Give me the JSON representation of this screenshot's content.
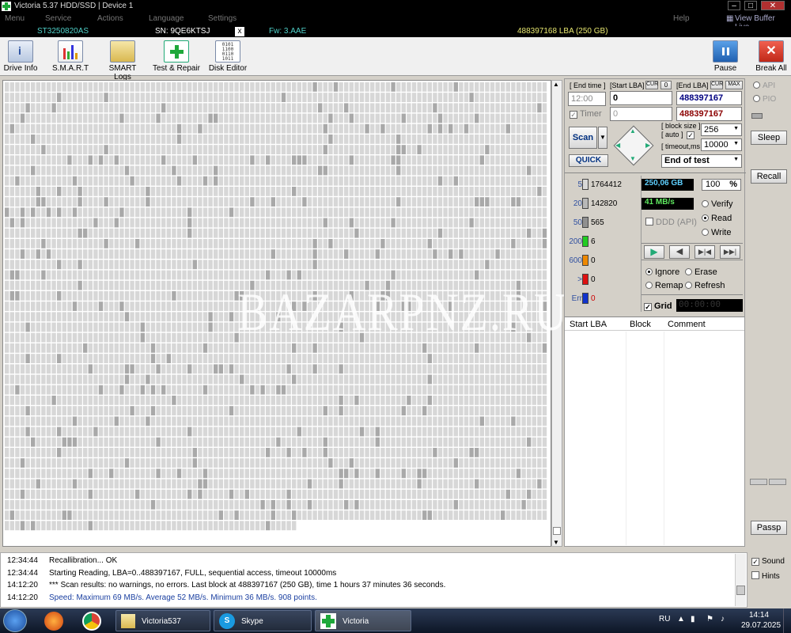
{
  "window": {
    "title": "Victoria 5.37 HDD/SSD | Device 1"
  },
  "menu": [
    "Menu",
    "Service",
    "Actions",
    "Language",
    "Settings"
  ],
  "help": "Help",
  "view_buffer": "View Buffer Live",
  "drive": {
    "model": "ST3250820AS",
    "serial": "SN: 9QE6KTSJ",
    "close": "x",
    "fw": "Fw: 3.AAE",
    "lba_info": "488397168 LBA (250 GB)"
  },
  "toolbar": {
    "drive_info": "Drive Info",
    "smart": "S.M.A.R.T",
    "smart_logs": "SMART Logs",
    "test_repair": "Test & Repair",
    "disk_editor": "Disk Editor",
    "pause": "Pause",
    "break_all": "Break All"
  },
  "params": {
    "end_time_label": "[ End time ]",
    "start_lba_label": "[Start LBA]",
    "cur_label": "CUR",
    "zero_label": "0",
    "end_lba_label": "[End LBA]",
    "cur2_label": "CUR",
    "max_label": "MAX",
    "end_time_value": "12:00",
    "start_lba_value": "0",
    "end_lba_value": "488397167",
    "timer_label": "Timer",
    "timer_value": "0",
    "end_lba_value2": "488397167",
    "block_size_label": "[ block size ]",
    "auto_label": "[ auto ]",
    "block_size": "256",
    "timeout_label": "[ timeout,ms ]",
    "timeout": "10000",
    "end_of_test": "End of test",
    "scan_label": "Scan",
    "quick_label": "QUICK"
  },
  "stats": [
    {
      "label": "5",
      "count": "1764412",
      "color": "#d8d8d8"
    },
    {
      "label": "20",
      "count": "142820",
      "color": "#b8b8b8"
    },
    {
      "label": "50",
      "count": "565",
      "color": "#909090"
    },
    {
      "label": "200",
      "count": "6",
      "color": "#22cc22"
    },
    {
      "label": "600",
      "count": "0",
      "color": "#ee8800"
    },
    {
      "label": ">",
      "count": "0",
      "color": "#dd1111"
    },
    {
      "label": "Err",
      "count": "0",
      "color": "#1133cc"
    }
  ],
  "readout": {
    "size": "250,06 GB",
    "percent": "100",
    "pct_sign": "%",
    "speed": "41 MB/s",
    "ddd": "DDD (API)",
    "verify": "Verify",
    "read": "Read",
    "write": "Write"
  },
  "actions": {
    "ignore": "Ignore",
    "erase": "Erase",
    "remap": "Remap",
    "refresh": "Refresh",
    "grid": "Grid",
    "timer_display": "00:00:00"
  },
  "table": {
    "headers": [
      "Start LBA",
      "Block",
      "Comment"
    ]
  },
  "side": {
    "api": "API",
    "pio": "PIO",
    "sleep": "Sleep",
    "recall": "Recall",
    "passp": "Passp"
  },
  "log": [
    {
      "time": "12:34:44",
      "msg": "Recallibration... OK",
      "color": "#000000"
    },
    {
      "time": "12:34:44",
      "msg": "Starting Reading, LBA=0..488397167, FULL, sequential access, timeout 10000ms",
      "color": "#000000"
    },
    {
      "time": "14:12:20",
      "msg": "*** Scan results: no warnings, no errors. Last block at 488397167 (250 GB), time 1 hours 37 minutes 36 seconds.",
      "color": "#000000"
    },
    {
      "time": "14:12:20",
      "msg": "Speed: Maximum 69 MB/s. Average 52 MB/s. Minimum 36 MB/s. 908 points.",
      "color": "#1a3fa0"
    }
  ],
  "log_opts": {
    "sound": "Sound",
    "hints": "Hints"
  },
  "watermark": "BAZARPNZ.RU",
  "taskbar": {
    "item1": "Victoria537",
    "item2": "Skype",
    "item3": "Victoria",
    "lang": "RU",
    "time": "14:14",
    "date": "29.07.2025"
  }
}
